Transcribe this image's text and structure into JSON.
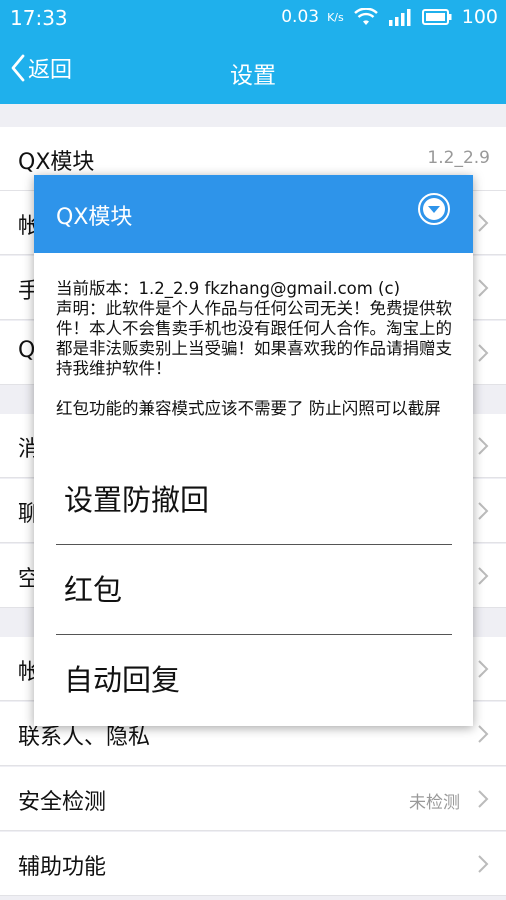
{
  "status_bar": {
    "time": "17:33",
    "net_speed": "0.03",
    "net_unit": "K/s",
    "battery": "100"
  },
  "header": {
    "back_label": "返回",
    "title": "设置"
  },
  "rows": [
    {
      "label": "QX模块",
      "value": "1.2_2.9"
    },
    {
      "label": "帐"
    },
    {
      "label": "手"
    },
    {
      "label": "Q"
    },
    {
      "label": "消"
    },
    {
      "label": "聊"
    },
    {
      "label": "空"
    },
    {
      "label": "帐"
    },
    {
      "label": "联系人、隐私"
    },
    {
      "label": "安全检测",
      "value": "未检测"
    },
    {
      "label": "辅助功能"
    }
  ],
  "dialog": {
    "title": "QX模块",
    "message": "当前版本：1.2_2.9 fkzhang@gmail.com (c)\n声明：此软件是个人作品与任何公司无关！免费提供软件！本人不会售卖手机也没有跟任何人合作。淘宝上的都是非法贩卖别上当受骗！如果喜欢我的作品请捐赠支持我维护软件！\n\n红包功能的兼容模式应该不需要了 防止闪照可以截屏",
    "options": [
      {
        "label": "设置防撤回"
      },
      {
        "label": "红包"
      },
      {
        "label": "自动回复"
      }
    ]
  },
  "colors": {
    "header_blue": "#1fb0ec",
    "dialog_blue": "#2e94ea"
  }
}
